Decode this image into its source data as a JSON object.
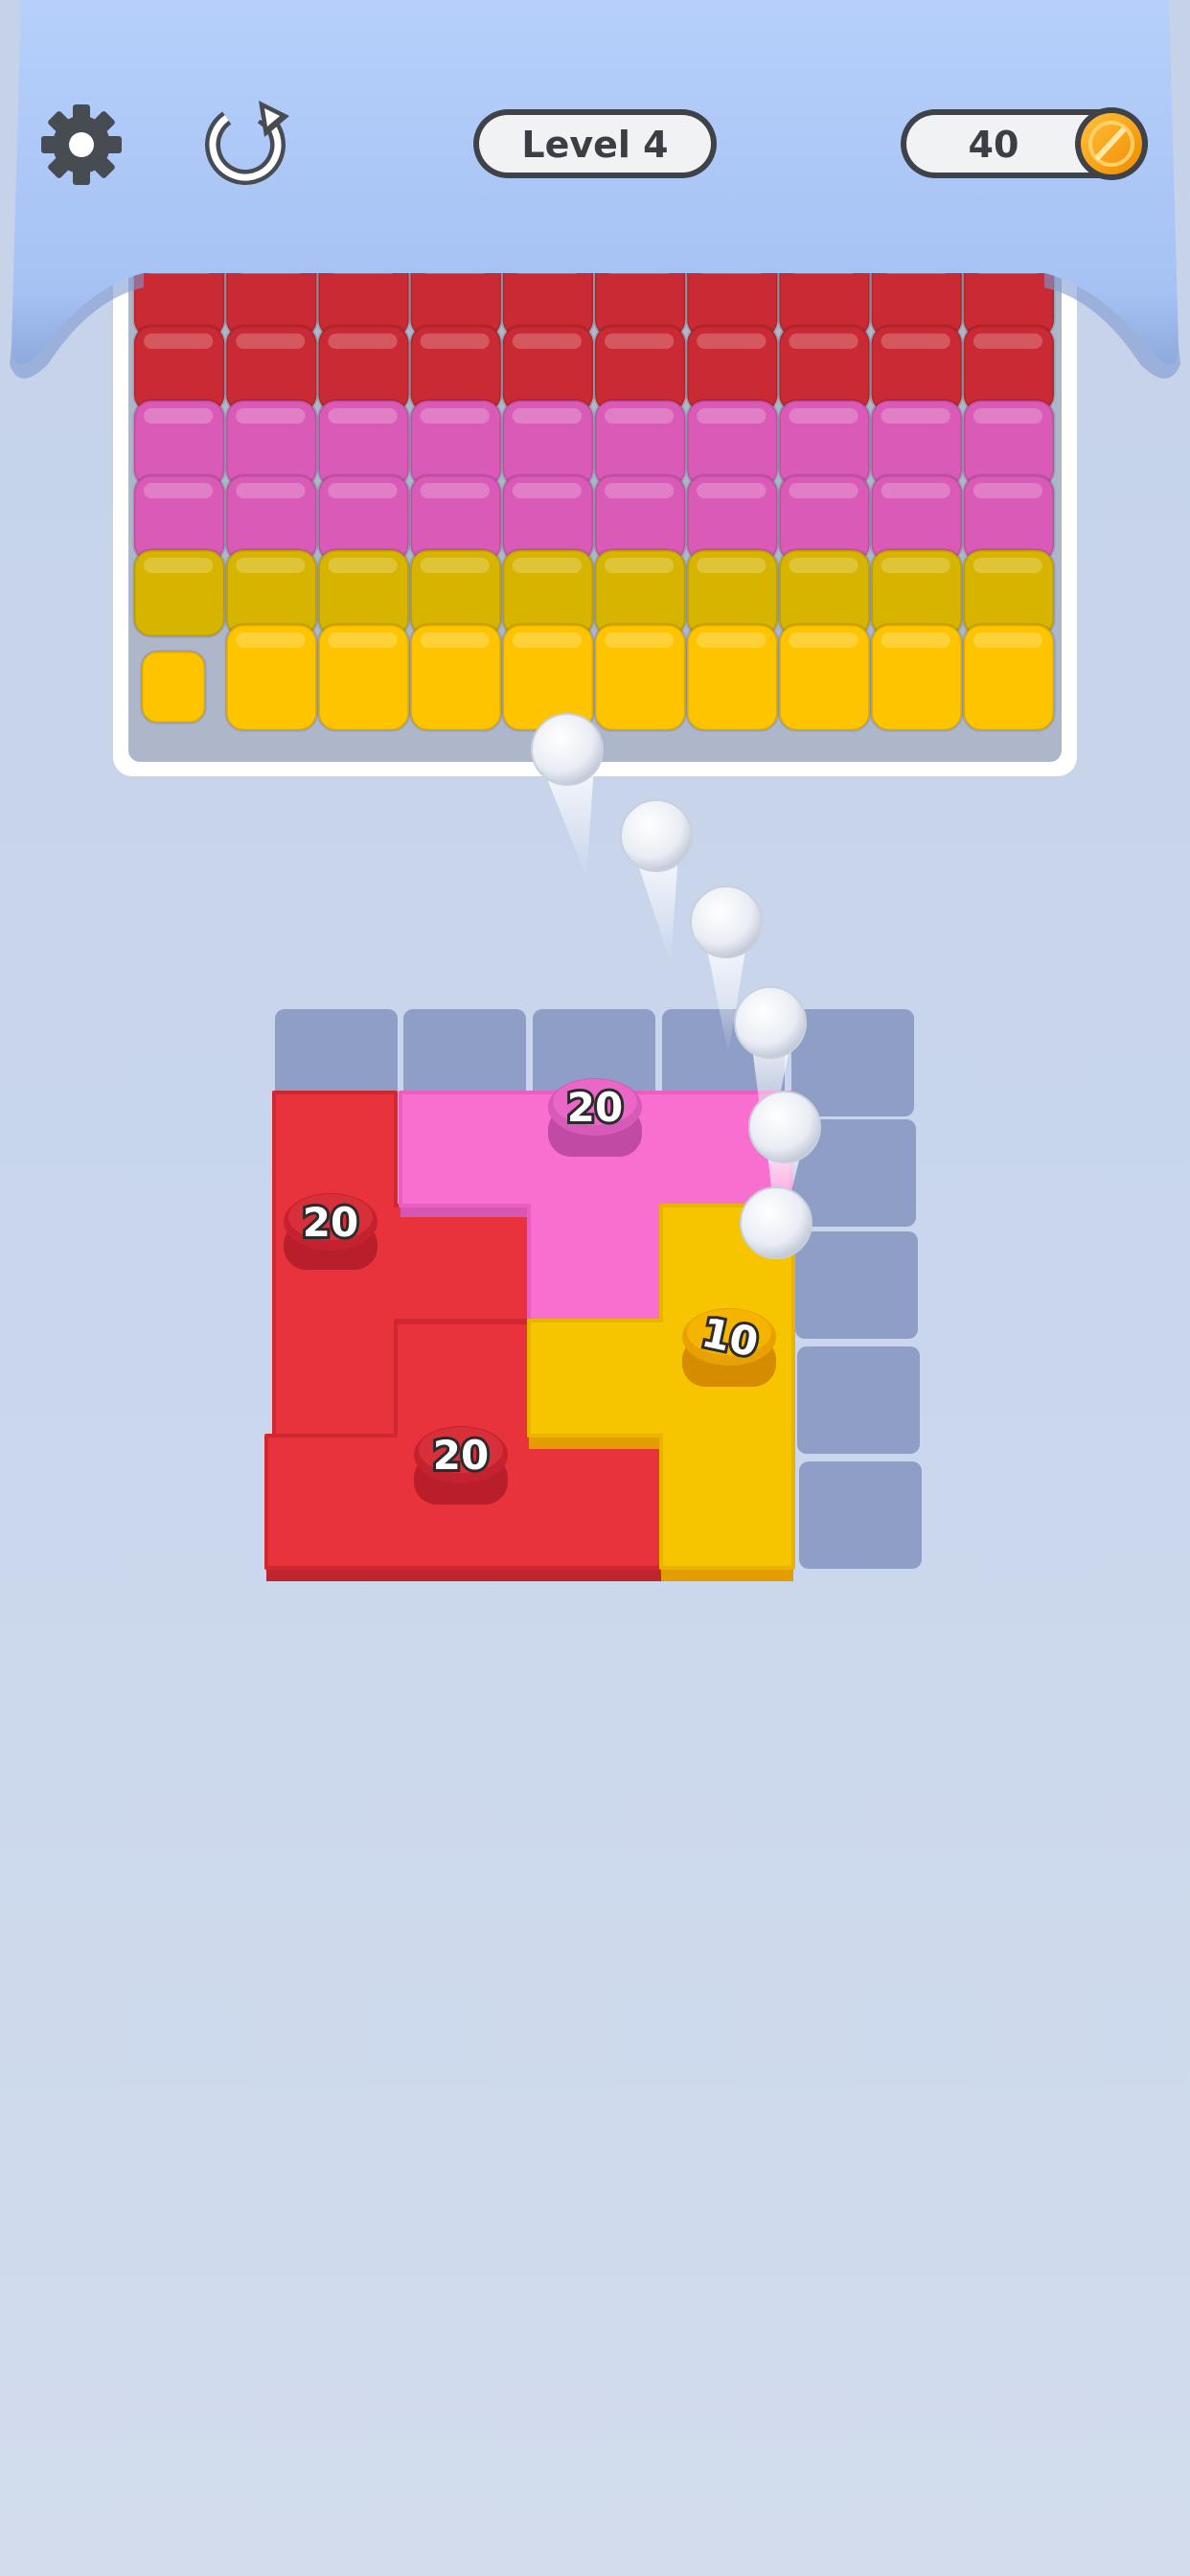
{
  "hud": {
    "settings_icon": "gear-icon",
    "restart_icon": "restart-icon",
    "level_label": "Level 4",
    "coin_count": "40",
    "coin_icon": "coin-icon"
  },
  "tray": {
    "columns": 10,
    "row_colors": [
      "#c92a33",
      "#c92a33",
      "#d95bb7",
      "#d95bb7",
      "#d6b400",
      "#ffc400"
    ]
  },
  "board": {
    "pieces": [
      {
        "name": "red-piece",
        "color": "#e8323c",
        "count": "20"
      },
      {
        "name": "pink-piece",
        "color": "#f86fcf",
        "count": "20"
      },
      {
        "name": "yellow-piece",
        "color": "#f6c500",
        "count": "10"
      },
      {
        "name": "red-piece-bottom",
        "color": "#e8323c",
        "count": "20"
      }
    ]
  },
  "colors": {
    "hopper": "#a9c6f6",
    "grid_cell": "#8e9ec6",
    "ball": "#f4f6fa",
    "coin": "#ff9e00"
  }
}
